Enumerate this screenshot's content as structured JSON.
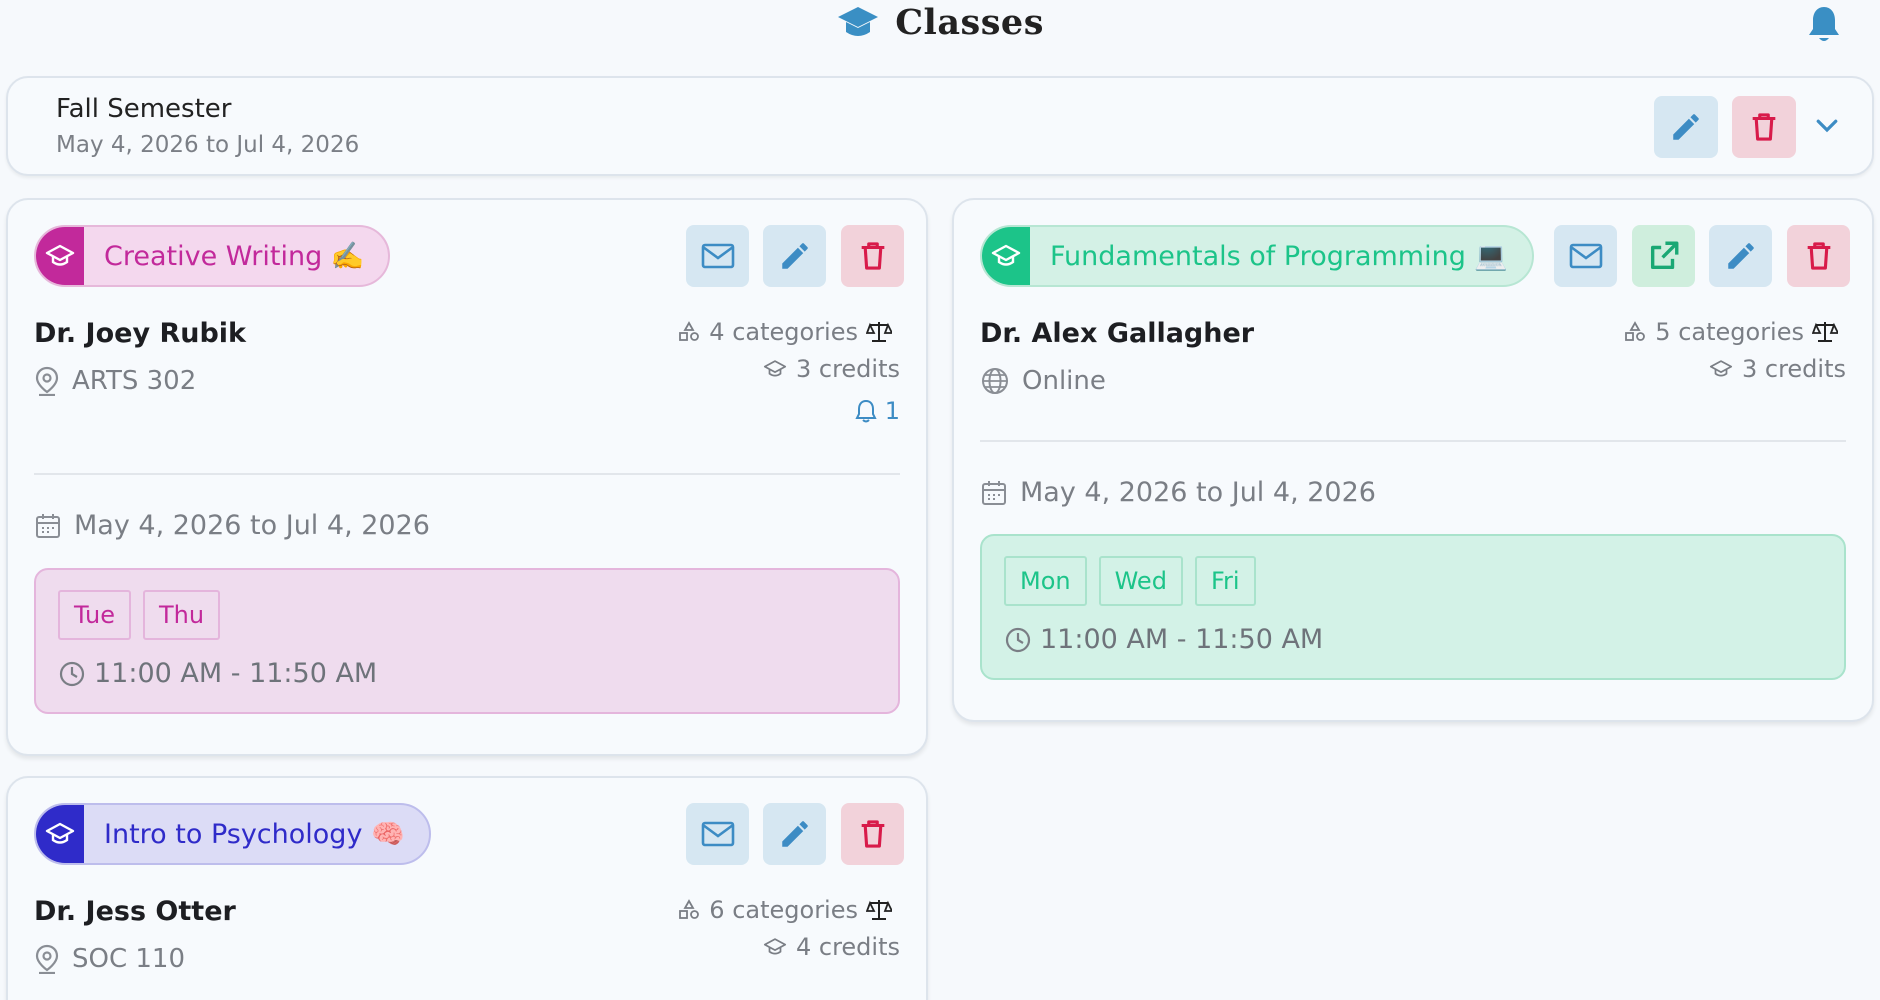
{
  "header": {
    "title": "Classes",
    "logo_icon": "graduation-cap-icon",
    "notification_icon": "bell-icon"
  },
  "semester": {
    "name": "Fall Semester",
    "dates": "May 4, 2026 to Jul 4, 2026",
    "actions": [
      "edit-icon",
      "delete-icon",
      "chevron-down-icon"
    ]
  },
  "colors": {
    "accent_blue": "#3d8cc4",
    "accent_red": "#d81b4a",
    "creative": "#c2299b",
    "programming": "#1cc489",
    "psychology": "#2f2bc9"
  },
  "classes": [
    {
      "name": "Creative Writing ✍️",
      "professor": "Dr. Joey Rubik",
      "location": "ARTS 302",
      "location_icon": "map-pin-icon",
      "categories": "4 categories",
      "credits": "3 credits",
      "notifications": "1",
      "dates": "May 4, 2026 to Jul 4, 2026",
      "days": [
        "Tue",
        "Thu"
      ],
      "time": "11:00 AM - 11:50 AM"
    },
    {
      "name": "Fundamentals of Programming 💻",
      "professor": "Dr. Alex Gallagher",
      "location": "Online",
      "location_icon": "globe-icon",
      "categories": "5 categories",
      "credits": "3 credits",
      "dates": "May 4, 2026 to Jul 4, 2026",
      "days": [
        "Mon",
        "Wed",
        "Fri"
      ],
      "time": "11:00 AM - 11:50 AM"
    },
    {
      "name": "Intro to Psychology 🧠",
      "professor": "Dr. Jess Otter",
      "location": "SOC 110",
      "location_icon": "map-pin-icon",
      "categories": "6 categories",
      "credits": "4 credits"
    }
  ]
}
